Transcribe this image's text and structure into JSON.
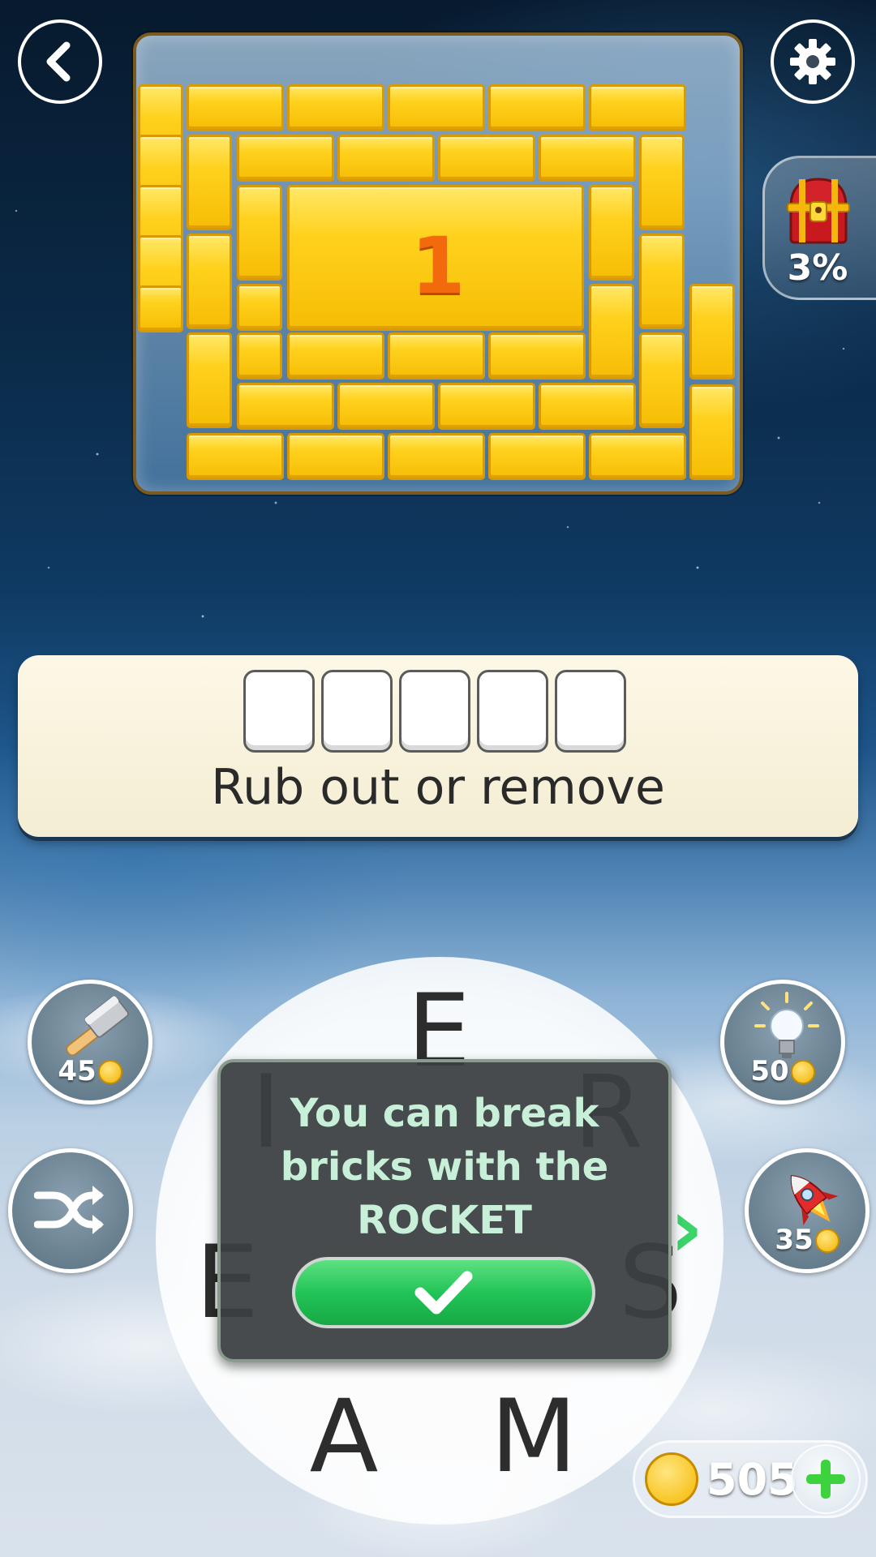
{
  "board": {
    "level_number": "1"
  },
  "treasure": {
    "progress": "3%",
    "icon": "treasure-chest-icon"
  },
  "clue": {
    "text": "Rub out or remove",
    "answer_length": 5
  },
  "powerups": {
    "hammer": {
      "cost": "45",
      "icon": "hammer-icon"
    },
    "hint": {
      "cost": "50",
      "icon": "lightbulb-icon"
    },
    "shuffle": {
      "icon": "shuffle-icon"
    },
    "rocket": {
      "cost": "35",
      "icon": "rocket-icon"
    }
  },
  "wheel": {
    "letters": [
      "E",
      "I",
      "R",
      "E",
      "S",
      "A",
      "M"
    ]
  },
  "tooltip": {
    "lines": [
      "You can break",
      "bricks with the",
      "ROCKET"
    ],
    "confirm_icon": "checkmark-icon"
  },
  "coins": {
    "count": "505",
    "add_icon": "plus-icon"
  },
  "colors": {
    "brick": "#ffd11d",
    "accent_green": "#22c458",
    "level_number": "#f26a0c"
  }
}
